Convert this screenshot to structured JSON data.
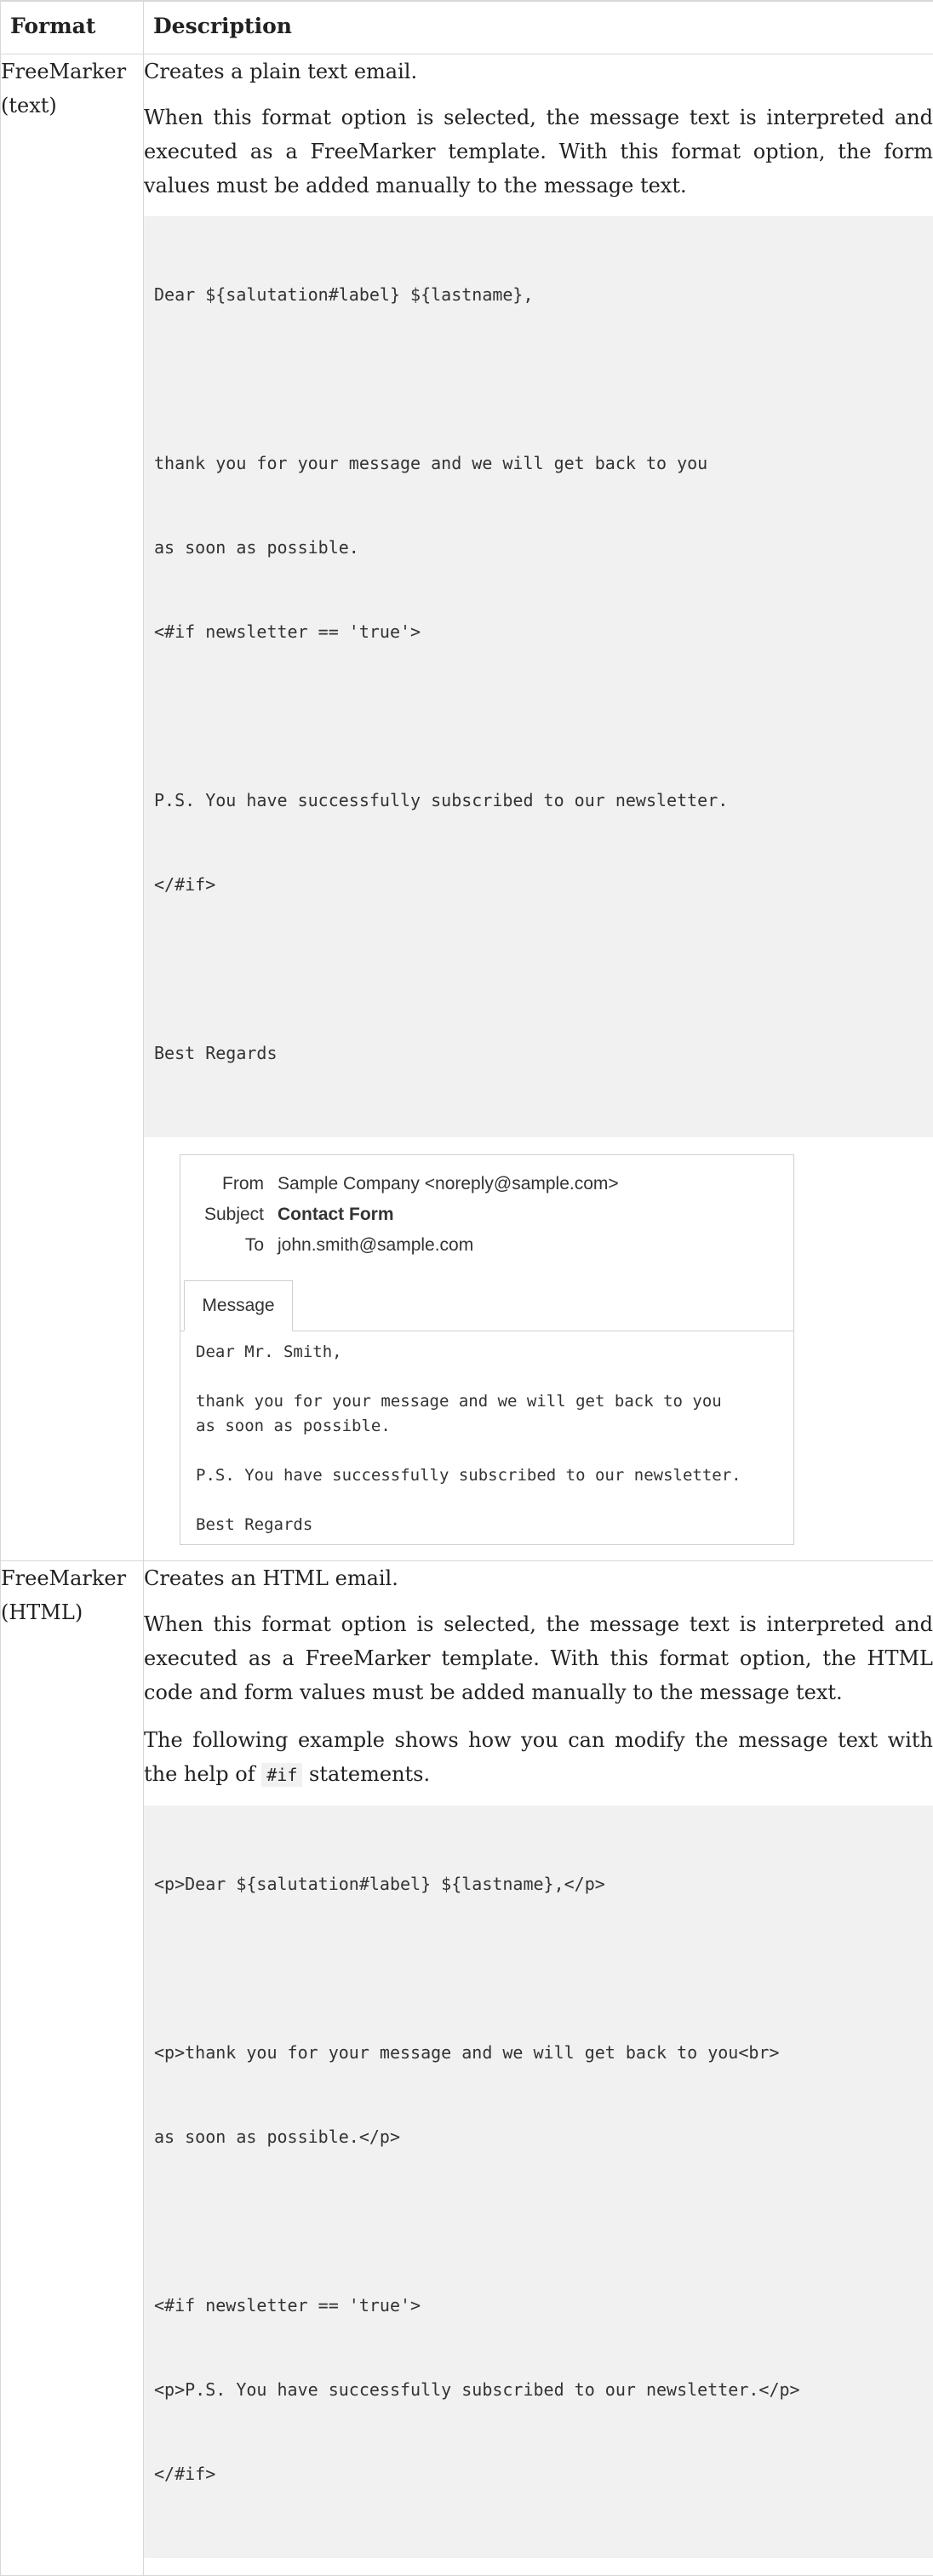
{
  "table": {
    "header": {
      "format": "Format",
      "description": "Description"
    },
    "rows": [
      {
        "format_line1": "FreeMarker",
        "format_line2": "(text)",
        "intro": "Creates a plain text email.",
        "paragraph": "When this format option is selected, the message text is interpreted and executed as a FreeMarker template. With this format option, the form values must be added manually to the message text.",
        "code_lines": [
          "Dear ${salutation#label} ${lastname},",
          "",
          "thank you for your message and we will get back to you",
          "as soon as possible.",
          "<#if newsletter == 'true'>",
          "",
          "P.S. You have successfully subscribed to our newsletter.",
          "</#if>",
          "",
          "Best Regards"
        ],
        "email": {
          "from_label": "From",
          "from_value": "Sample Company <noreply@sample.com>",
          "subject_label": "Subject",
          "subject_value": "Contact Form",
          "to_label": "To",
          "to_value": "john.smith@sample.com",
          "tab_label": "Message",
          "body_lines": [
            "Dear Mr. Smith,",
            "",
            "thank you for your message and we will get back to you",
            "as soon as possible.",
            "",
            "P.S. You have successfully subscribed to our newsletter.",
            "",
            "Best Regards"
          ]
        }
      },
      {
        "format_line1": "FreeMarker",
        "format_line2": "(HTML)",
        "intro": "Creates an HTML email.",
        "paragraph": "When this format option is selected, the message text is interpreted and executed as a FreeMarker template. With this format option, the HTML code and form values must be added manually to the message text.",
        "example_before": "The following example shows how you can modify the message text with the help of",
        "example_code": "#if",
        "example_after": "statements.",
        "code_lines": [
          "<p>Dear ${salutation#label} ${lastname},</p>",
          "",
          "<p>thank you for your message and we will get back to you<br>",
          "as soon as possible.</p>",
          "",
          "<#if newsletter == 'true'>",
          "<p>P.S. You have successfully subscribed to our newsletter.</p>",
          "</#if>"
        ]
      }
    ]
  }
}
